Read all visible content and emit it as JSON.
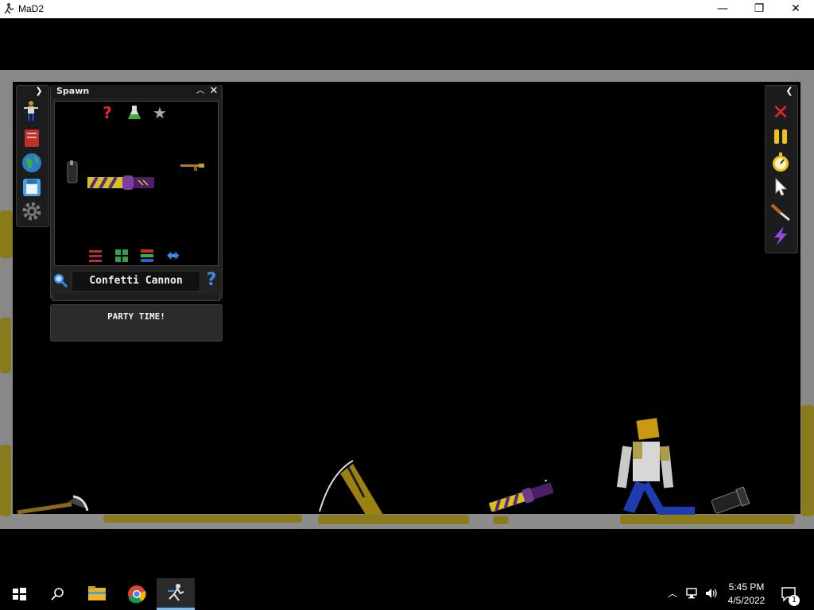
{
  "window": {
    "title": "MaD2",
    "minimize_glyph": "—",
    "restore_glyph": "❐",
    "close_glyph": "✕"
  },
  "left_toolbar": {
    "items": [
      {
        "icon": "character-icon"
      },
      {
        "icon": "book-icon"
      },
      {
        "icon": "globe-icon"
      },
      {
        "icon": "save-icon"
      },
      {
        "icon": "gear-icon"
      }
    ]
  },
  "spawn_panel": {
    "title": "Spawn",
    "category_tabs": [
      "question-mark-icon",
      "flask-icon",
      "star-icon"
    ],
    "bottom_tabs": [
      "sliders-icon",
      "grid-icon",
      "layers-icon",
      "swap-arrows-icon"
    ],
    "selected_item": "Confetti Cannon",
    "description": "PARTY TIME!"
  },
  "right_toolbar": {
    "items": [
      {
        "icon": "close-x-icon"
      },
      {
        "icon": "pause-icon"
      },
      {
        "icon": "stopwatch-icon"
      },
      {
        "icon": "cursor-icon"
      },
      {
        "icon": "knife-icon"
      },
      {
        "icon": "lightning-icon"
      }
    ]
  },
  "taskbar": {
    "apps": [
      "windows-start-icon",
      "search-icon",
      "file-explorer-icon",
      "chrome-icon",
      "mad2-app-icon"
    ],
    "time": "5:45 PM",
    "date": "4/5/2022",
    "notification_count": "1"
  },
  "colors": {
    "accent_gold": "#c9a316",
    "confetti_purple": "#5b2a7a",
    "ragdoll_head": "#c99a10",
    "ragdoll_legs": "#1f3bb0",
    "close_red": "#e02a2a"
  }
}
